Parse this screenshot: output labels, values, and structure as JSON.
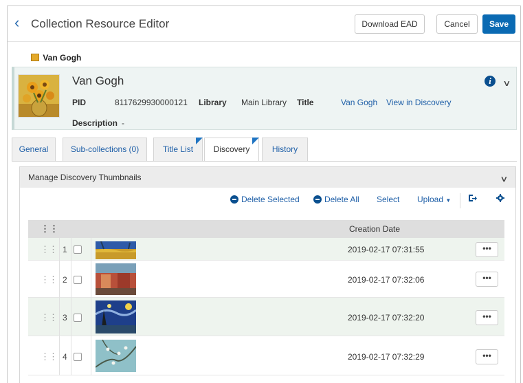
{
  "header": {
    "title": "Collection Resource Editor",
    "download_ead": "Download EAD",
    "cancel": "Cancel",
    "save": "Save"
  },
  "breadcrumb": {
    "label": "Van Gogh"
  },
  "resource": {
    "name": "Van Gogh",
    "pid_label": "PID",
    "pid_value": "8117629930000121",
    "library_label": "Library",
    "library_value": "Main Library",
    "title_label": "Title",
    "title_value": "Van Gogh",
    "view_link": "View in Discovery",
    "description_label": "Description",
    "description_value": "-"
  },
  "tabs": [
    {
      "label": "General"
    },
    {
      "label": "Sub-collections (0)"
    },
    {
      "label": "Title List"
    },
    {
      "label": "Discovery"
    },
    {
      "label": "History"
    }
  ],
  "panel": {
    "title": "Manage Discovery Thumbnails",
    "delete_selected": "Delete Selected",
    "delete_all": "Delete All",
    "select": "Select",
    "upload": "Upload"
  },
  "table": {
    "header_date": "Creation Date",
    "rows": [
      {
        "num": "1",
        "date": "2019-02-17 07:31:55",
        "more": "•••"
      },
      {
        "num": "2",
        "date": "2019-02-17 07:32:06",
        "more": "•••"
      },
      {
        "num": "3",
        "date": "2019-02-17 07:32:20",
        "more": "•••"
      },
      {
        "num": "4",
        "date": "2019-02-17 07:32:29",
        "more": "•••"
      }
    ]
  },
  "colors": {
    "accent": "#0a6ab3",
    "link": "#2060a8",
    "card_bg": "#eef4f3",
    "row_alt": "#eef4ee"
  }
}
